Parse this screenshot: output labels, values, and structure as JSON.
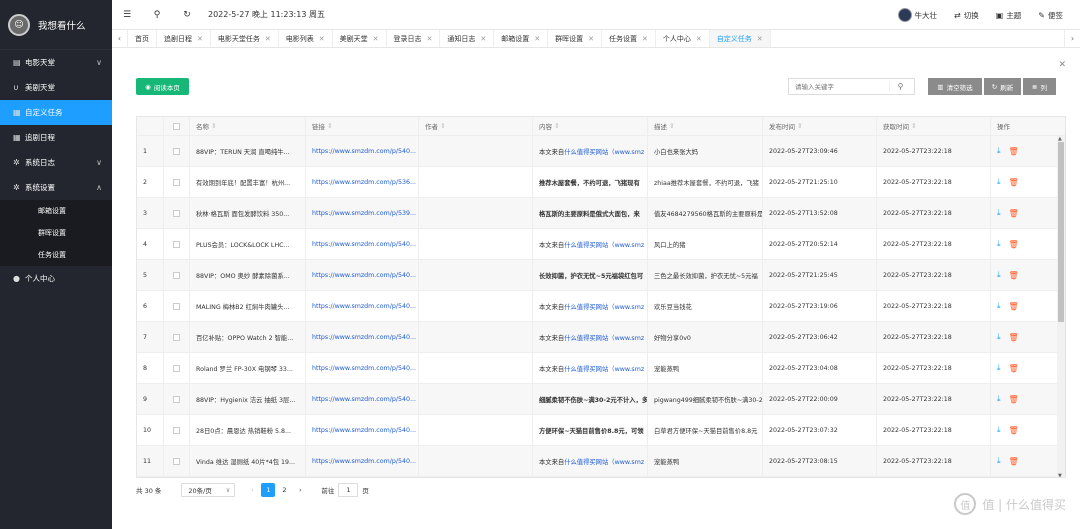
{
  "app": {
    "title": "我想看什么"
  },
  "sidebar": {
    "items": [
      {
        "label": "电影天堂",
        "icon": "document-icon",
        "chevron": "∨"
      },
      {
        "label": "美剧天堂",
        "icon": "magnet-icon",
        "chevron": ""
      },
      {
        "label": "自定义任务",
        "icon": "calendar-icon",
        "chevron": ""
      },
      {
        "label": "追剧日程",
        "icon": "calendar-icon",
        "chevron": ""
      },
      {
        "label": "系统日志",
        "icon": "gear-icon",
        "chevron": "∨"
      },
      {
        "label": "系统设置",
        "icon": "gear-icon",
        "chevron": "∧"
      }
    ],
    "sub_items": [
      {
        "label": "邮箱设置"
      },
      {
        "label": "群晖设置"
      },
      {
        "label": "任务设置"
      }
    ],
    "user_center": {
      "label": "个人中心"
    }
  },
  "topbar": {
    "datetime": "2022-5-27 晚上 11:23:13 周五",
    "username": "牛大壮",
    "switch_label": "切换",
    "theme_label": "主题",
    "note_label": "便签"
  },
  "tabs": [
    {
      "label": "首页",
      "closable": false
    },
    {
      "label": "追剧日程",
      "closable": true
    },
    {
      "label": "电影天堂任务",
      "closable": true
    },
    {
      "label": "电影列表",
      "closable": true
    },
    {
      "label": "美剧天堂",
      "closable": true
    },
    {
      "label": "登录日志",
      "closable": true
    },
    {
      "label": "通知日志",
      "closable": true
    },
    {
      "label": "邮箱设置",
      "closable": true
    },
    {
      "label": "群晖设置",
      "closable": true
    },
    {
      "label": "任务设置",
      "closable": true
    },
    {
      "label": "个人中心",
      "closable": true
    },
    {
      "label": "自定义任务",
      "closable": true,
      "active": true
    }
  ],
  "toolbar": {
    "read_btn": "阅读本页",
    "search_placeholder": "请输入关键字",
    "clear_filter": "清空筛选",
    "refresh": "刷新",
    "columns": "列"
  },
  "table": {
    "headers": [
      "名称",
      "链接",
      "作者",
      "内容",
      "描述",
      "发布时间",
      "获取时间",
      "操作"
    ],
    "rows": [
      {
        "no": "1",
        "name": "88VIP：TERUN 天润 直喝纯牛...",
        "link": "https://www.smzdm.com/p/540...",
        "author": "",
        "content": "本文来自什么值得买网站（www.smz",
        "content_style": "normal",
        "desc": "小白也来张大妈",
        "pub": "2022-05-27T23:09:46",
        "got": "2022-05-27T23:22:18"
      },
      {
        "no": "2",
        "name": "有效期到年底！配置丰富！杭州...",
        "link": "https://www.smzdm.com/p/536...",
        "author": "",
        "content": "推荐木屋套餐，不约可退，飞猪现有",
        "content_style": "bold",
        "desc": "zhiaa推荐木屋套餐，不约可退，飞猪",
        "pub": "2022-05-27T21:25:10",
        "got": "2022-05-27T23:22:18"
      },
      {
        "no": "3",
        "name": "秋林·格瓦斯 面包发酵饮料 350...",
        "link": "https://www.smzdm.com/p/539...",
        "author": "",
        "content": "格瓦斯的主要原料是俄式大面包，来",
        "content_style": "bold",
        "desc": "值友4684279560格瓦斯的主要原料是",
        "pub": "2022-05-27T13:52:08",
        "got": "2022-05-27T23:22:18"
      },
      {
        "no": "4",
        "name": "PLUS会员：LOCK&LOCK LHC...",
        "link": "https://www.smzdm.com/p/540...",
        "author": "",
        "content": "本文来自什么值得买网站（www.smz",
        "content_style": "normal",
        "desc": "风口上的猪",
        "pub": "2022-05-27T20:52:14",
        "got": "2022-05-27T23:22:18"
      },
      {
        "no": "5",
        "name": "88VIP：OMO 奥妙 酵素除菌系...",
        "link": "https://www.smzdm.com/p/540...",
        "author": "",
        "content": "长效抑菌，护衣无忧~5元福袋红包可",
        "content_style": "bold",
        "desc": "三色之最长效抑菌，护衣无忧~5元福",
        "pub": "2022-05-27T21:25:45",
        "got": "2022-05-27T23:22:18"
      },
      {
        "no": "6",
        "name": "MALING 梅林B2 红焖牛肉罐头...",
        "link": "https://www.smzdm.com/p/540...",
        "author": "",
        "content": "本文来自什么值得买网站（www.smz",
        "content_style": "normal",
        "desc": "欢乐豆当钱花",
        "pub": "2022-05-27T23:19:06",
        "got": "2022-05-27T23:22:18"
      },
      {
        "no": "7",
        "name": "百亿补贴：OPPO Watch 2 智能...",
        "link": "https://www.smzdm.com/p/540...",
        "author": "",
        "content": "本文来自什么值得买网站（www.smz",
        "content_style": "normal",
        "desc": "好物分享0v0",
        "pub": "2022-05-27T23:06:42",
        "got": "2022-05-27T23:22:18"
      },
      {
        "no": "8",
        "name": "Roland 罗兰 FP-30X 电钢琴 33...",
        "link": "https://www.smzdm.com/p/540...",
        "author": "",
        "content": "本文来自什么值得买网站（www.smz",
        "content_style": "normal",
        "desc": "宠能蒸鸭",
        "pub": "2022-05-27T23:04:08",
        "got": "2022-05-27T23:22:18"
      },
      {
        "no": "9",
        "name": "88VIP：Hygienix 洁云 抽纸 3层...",
        "link": "https://www.smzdm.com/p/540...",
        "author": "",
        "content": "细腻柔韧不伤肤~满30-2元不计入，多",
        "content_style": "bold",
        "desc": "pigwang499细腻柔韧不伤肤~满30-2",
        "pub": "2022-05-27T22:00:09",
        "got": "2022-05-27T23:22:18"
      },
      {
        "no": "10",
        "name": "28日0点：晨恩达 热销鞋粉 5.8...",
        "link": "https://www.smzdm.com/p/540...",
        "author": "",
        "content": "方便环保~天猫目前售价8.8元，可领",
        "content_style": "bold",
        "desc": "白草君方便环保~天猫目前售价8.8元",
        "pub": "2022-05-27T23:07:32",
        "got": "2022-05-27T23:22:18"
      },
      {
        "no": "11",
        "name": "Vinda 维达 湿厕纸 40片*4包 19...",
        "link": "https://www.smzdm.com/p/540...",
        "author": "",
        "content": "本文来自什么值得买网站（www.smz",
        "content_style": "normal",
        "desc": "宠能蒸鸭",
        "pub": "2022-05-27T23:08:15",
        "got": "2022-05-27T23:22:18"
      }
    ]
  },
  "pager": {
    "total": "共 30 条",
    "page_size": "20条/页",
    "pages": [
      "1",
      "2"
    ],
    "current": "1",
    "goto_label": "前往",
    "goto_value": "1",
    "page_unit": "页"
  },
  "watermark": {
    "text": "值 | 什么值得买"
  },
  "colors": {
    "sidebar_bg": "#23262e",
    "accent": "#1e9fff",
    "green": "#16b777",
    "delete": "#ff5722"
  }
}
